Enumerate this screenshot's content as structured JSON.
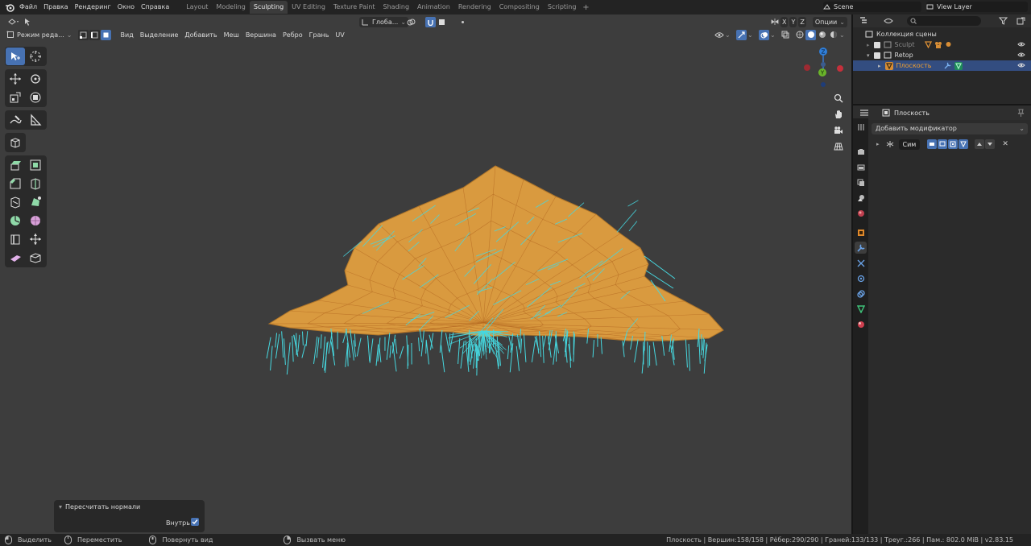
{
  "top_menu": {
    "items": [
      "Файл",
      "Правка",
      "Рендеринг",
      "Окно",
      "Справка"
    ]
  },
  "workspaces": {
    "tabs": [
      "Layout",
      "Modeling",
      "Sculpting",
      "UV Editing",
      "Texture Paint",
      "Shading",
      "Animation",
      "Rendering",
      "Compositing",
      "Scripting"
    ],
    "active": "Sculpting"
  },
  "scene": {
    "name": "Scene"
  },
  "view_layer": {
    "name": "View Layer"
  },
  "viewport": {
    "mode": "Режим реда...",
    "menus": [
      "Вид",
      "Выделение",
      "Добавить",
      "Меш",
      "Вершина",
      "Ребро",
      "Грань",
      "UV"
    ],
    "orientation": "Глоба...",
    "options": "Опции",
    "axes": [
      "X",
      "Y",
      "Z"
    ]
  },
  "operator_panel": {
    "title": "Пересчитать нормали",
    "inside_label": "Внутрь",
    "inside_checked": true
  },
  "statusbar": {
    "select": "Выделить",
    "move": "Переместить",
    "rotate_view": "Повернуть вид",
    "call_menu": "Вызвать меню",
    "stats": "Плоскость | Вершин:158/158 | Рёбер:290/290 | Граней:133/133 | Треуг.:266 | Пам.: 802.0 MiB | v2.83.15"
  },
  "outliner": {
    "collection": "Коллекция сцены",
    "items": [
      {
        "name": "Sculpt",
        "muted": true
      },
      {
        "name": "Retop",
        "muted": false
      },
      {
        "name": "Плоскость",
        "selected": true
      }
    ]
  },
  "properties": {
    "object_name": "Плоскость",
    "add_modifier": "Добавить модификатор",
    "modifier_name": "Сим"
  },
  "colors": {
    "accent": "#4772b3",
    "mesh_face": "#d99a3f",
    "normals": "#46d8e0",
    "selected_text": "#f0a030"
  }
}
